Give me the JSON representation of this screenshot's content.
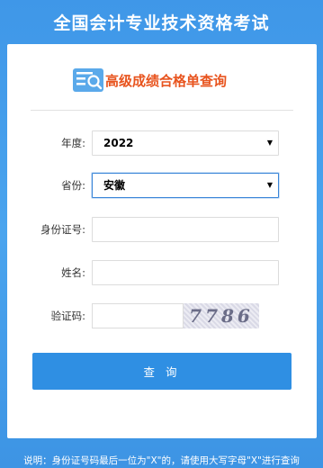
{
  "header": {
    "title": "全国会计专业技术资格考试"
  },
  "card": {
    "title": "高级成绩合格单查询"
  },
  "form": {
    "year": {
      "label": "年度:",
      "value": "2022"
    },
    "province": {
      "label": "省份:",
      "value": "安徽"
    },
    "id_number": {
      "label": "身份证号:",
      "value": ""
    },
    "name": {
      "label": "姓名:",
      "value": ""
    },
    "captcha": {
      "label": "验证码:",
      "value": "",
      "image_text": "7786"
    }
  },
  "buttons": {
    "query_label": "查 询"
  },
  "note": "说明：身份证号码最后一位为\"X\"的，请使用大写字母\"X\"进行查询",
  "colors": {
    "primary": "#2f8fe3",
    "title_accent": "#e8541e",
    "background": "#4aa4ee"
  },
  "icons": {
    "logo": "search-document-icon",
    "dropdown": "dropdown-arrow-icon"
  }
}
